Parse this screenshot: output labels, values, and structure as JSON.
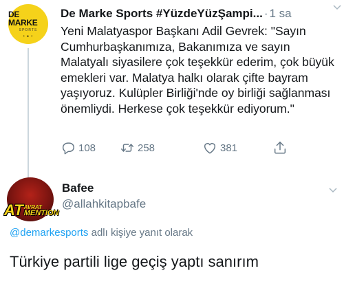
{
  "tweet": {
    "author_name": "De Marke Sports #YüzdeYüzŞampi...",
    "time_separator": "·",
    "time": "1 sa",
    "avatar_logo": {
      "main": "DE MARKE",
      "sub": "SPORTS",
      "dots": "• ● •"
    },
    "text": "Yeni Malatyaspor Başkanı Adil Gevrek: \"Sayın Cumhurbaşkanımıza, Bakanımıza ve sayın Malatyalı siyasilere çok teşekkür ederim, çok büyük emekleri var. Malatya halkı olarak çifte bayram yaşıyoruz. Kulüpler Birliği'nde oy birliği sağlanması önemliydi. Herkese çok teşekkür ediyorum.\"",
    "actions": {
      "reply_count": "108",
      "retweet_count": "258",
      "like_count": "381"
    },
    "icons": {
      "reply": "reply-icon",
      "retweet": "retweet-icon",
      "like": "heart-icon",
      "share": "share-icon",
      "more": "chevron-down-icon"
    }
  },
  "reply": {
    "author_name": "Bafee",
    "handle": "@allahkitapbafe",
    "avatar_banner": {
      "at": "AT",
      "avrat": "AVRAT",
      "mention": "MENTION"
    },
    "reply_to_mention": "@demarkesports",
    "reply_to_suffix": " adlı kişiye yanıt olarak",
    "text": "Türkiye partili lige geçiş yaptı sanırım"
  },
  "colors": {
    "text_primary": "#14171a",
    "text_secondary": "#657786",
    "link": "#1da1f2",
    "logo_yellow": "#f5d21a",
    "thread_line": "#ccd6dd"
  }
}
